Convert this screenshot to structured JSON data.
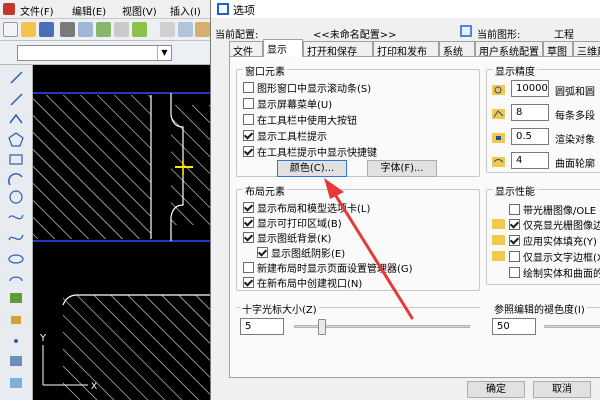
{
  "cad": {
    "menu": [
      "文件(F)",
      "编辑(E)",
      "视图(V)",
      "插入(I)"
    ],
    "canvas_axis_label": "Y"
  },
  "dialog": {
    "title": "选项",
    "current_profile_label": "当前配置:",
    "current_profile_value": "<<未命名配置>>",
    "current_drawing_label": "当前图形:",
    "current_drawing_value": "工程",
    "tabs": [
      "文件",
      "显示",
      "打开和保存",
      "打印和发布",
      "系统",
      "用户系统配置",
      "草图",
      "三维建"
    ],
    "active_tab_index": 1,
    "window_elements": {
      "title": "窗口元素",
      "options": [
        {
          "label": "图形窗口中显示滚动条(S)",
          "checked": false
        },
        {
          "label": "显示屏幕菜单(U)",
          "checked": false
        },
        {
          "label": "在工具栏中使用大按钮",
          "checked": false
        },
        {
          "label": "显示工具栏提示",
          "checked": true
        },
        {
          "label": "在工具栏提示中显示快捷键",
          "checked": true
        }
      ],
      "colors_button": "颜色(C)...",
      "fonts_button": "字体(F)..."
    },
    "layout_elements": {
      "title": "布局元素",
      "options": [
        {
          "label": "显示布局和模型选项卡(L)",
          "checked": true
        },
        {
          "label": "显示可打印区域(B)",
          "checked": true
        },
        {
          "label": "显示图纸背景(K)",
          "checked": true
        },
        {
          "label": "显示图纸阴影(E)",
          "checked": true
        },
        {
          "label": "新建布局时显示页面设置管理器(G)",
          "checked": false
        },
        {
          "label": "在新布局中创建视口(N)",
          "checked": true
        }
      ]
    },
    "crosshair": {
      "title": "十字光标大小(Z)",
      "value": "5",
      "fraction": 0.05
    },
    "display_resolution": {
      "title": "显示精度",
      "items": [
        {
          "value": "10000",
          "label": "圆弧和圆"
        },
        {
          "value": "8",
          "label": "每条多段"
        },
        {
          "value": "0.5",
          "label": "渲染对象"
        },
        {
          "value": "4",
          "label": "曲面轮廓"
        }
      ]
    },
    "display_performance": {
      "title": "显示性能",
      "items": [
        {
          "label": "带光栅图像/OLE 平",
          "checked": false
        },
        {
          "label": "仅亮显光栅图像边",
          "checked": true
        },
        {
          "label": "应用实体填充(Y)",
          "checked": true
        },
        {
          "label": "仅显示文字边框(X)",
          "checked": false
        },
        {
          "label": "绘制实体和曲面的",
          "checked": false
        }
      ]
    },
    "xref_fading": {
      "title": "参照编辑的褪色度(I)",
      "value": "50"
    },
    "ok_button": "确定",
    "cancel_button": "取消"
  },
  "colors": {
    "accent_arrow": "#e53935",
    "cad_line_blue": "#2f4bff",
    "cad_yellow": "#ffe600"
  }
}
